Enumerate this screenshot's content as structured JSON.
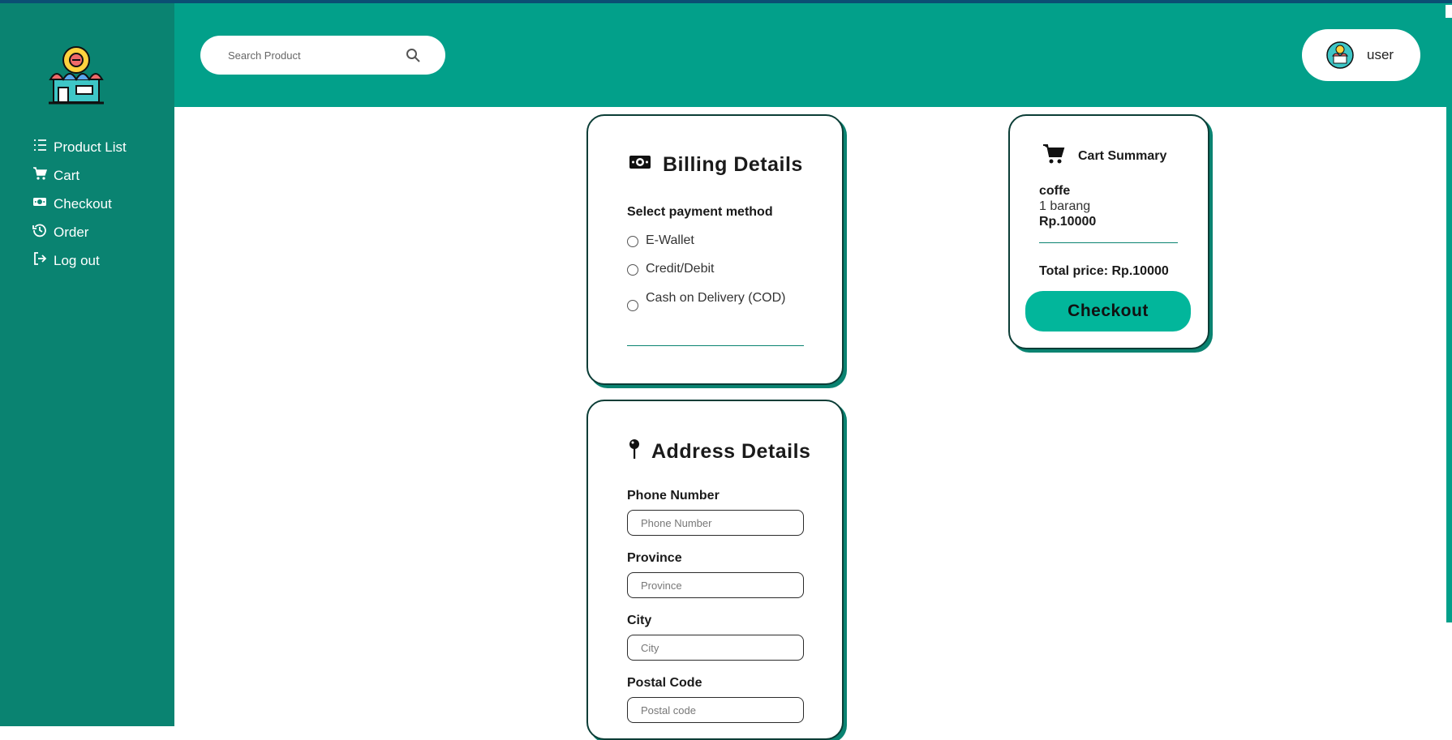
{
  "app": {
    "brand_colors": {
      "sidebar": "#0a8371",
      "header": "#02a08a",
      "button": "#02b69b"
    },
    "logo_icon": "shop-logo-icon"
  },
  "sidebar": {
    "items": [
      {
        "label": "Product List",
        "icon": "list-icon"
      },
      {
        "label": "Cart",
        "icon": "cart-icon"
      },
      {
        "label": "Checkout",
        "icon": "money-icon"
      },
      {
        "label": "Order",
        "icon": "history-icon"
      },
      {
        "label": "Log out",
        "icon": "logout-icon"
      }
    ]
  },
  "header": {
    "search": {
      "placeholder": "Search Product",
      "icon": "search-icon"
    },
    "user": {
      "name": "user",
      "icon": "avatar-icon"
    }
  },
  "billing": {
    "title": "Billing Details",
    "icon": "money-icon",
    "payment_label": "Select payment method",
    "options": [
      "E-Wallet",
      "Credit/Debit",
      "Cash on Delivery (COD)"
    ]
  },
  "address": {
    "title": "Address Details",
    "icon": "pin-icon",
    "fields": [
      {
        "label": "Phone Number",
        "placeholder": "Phone Number"
      },
      {
        "label": "Province",
        "placeholder": "Province"
      },
      {
        "label": "City",
        "placeholder": "City"
      },
      {
        "label": "Postal Code",
        "placeholder": "Postal code"
      }
    ]
  },
  "cart": {
    "title": "Cart Summary",
    "icon": "cart-icon",
    "item": {
      "name": "coffe",
      "qty": "1 barang",
      "price": "Rp.10000"
    },
    "total": "Total price: Rp.10000",
    "checkout_label": "Checkout"
  }
}
